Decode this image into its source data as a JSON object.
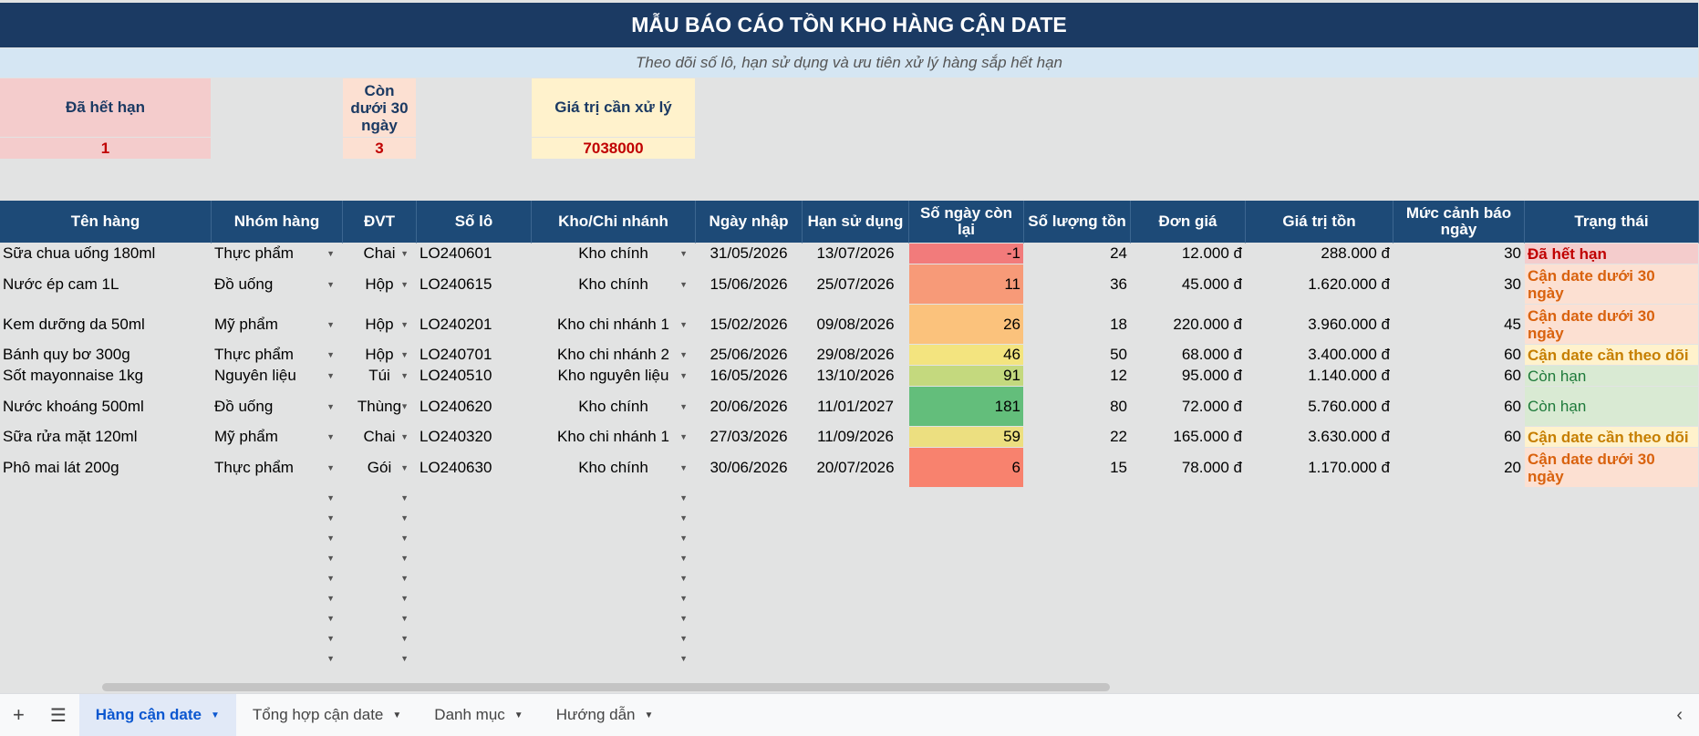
{
  "title": "MẪU BÁO CÁO TỒN KHO HÀNG CẬN DATE",
  "subtitle": "Theo dõi số lô, hạn sử dụng và ưu tiên xử lý hàng sắp hết hạn",
  "summary": {
    "expired_label": "Đã hết hạn",
    "expired_value": "1",
    "under30_label": "Còn dưới 30 ngày",
    "under30_value": "3",
    "value_label": "Giá trị cần xử lý",
    "value_value": "7038000"
  },
  "columns": [
    "Tên hàng",
    "Nhóm hàng",
    "ĐVT",
    "Số lô",
    "Kho/Chi nhánh",
    "Ngày nhập",
    "Hạn sử dụng",
    "Số ngày còn lại",
    "Số lượng tồn",
    "Đơn giá",
    "Giá trị tồn",
    "Mức cảnh báo ngày",
    "Trạng thái"
  ],
  "rows": [
    {
      "name": "Sữa chua uống 180ml",
      "group": "Thực phẩm",
      "unit": "Chai",
      "lot": "LO240601",
      "warehouse": "Kho chính",
      "in_date": "31/05/2026",
      "exp_date": "13/07/2026",
      "days": "-1",
      "qty": "24",
      "price": "12.000 đ",
      "value": "288.000 đ",
      "warn": "30",
      "status": "Đã hết hạn",
      "days_color": "#f27b7b",
      "status_type": "exp"
    },
    {
      "name": "Nước ép cam 1L",
      "group": "Đồ uống",
      "unit": "Hộp",
      "lot": "LO240615",
      "warehouse": "Kho chính",
      "in_date": "15/06/2026",
      "exp_date": "25/07/2026",
      "days": "11",
      "qty": "36",
      "price": "45.000 đ",
      "value": "1.620.000 đ",
      "warn": "30",
      "status": "Cận date dưới 30 ngày",
      "days_color": "#f79a78",
      "status_type": "soon"
    },
    {
      "name": "Kem dưỡng da 50ml",
      "group": "Mỹ phẩm",
      "unit": "Hộp",
      "lot": "LO240201",
      "warehouse": "Kho chi nhánh 1",
      "in_date": "15/02/2026",
      "exp_date": "09/08/2026",
      "days": "26",
      "qty": "18",
      "price": "220.000 đ",
      "value": "3.960.000 đ",
      "warn": "45",
      "status": "Cận date dưới 30 ngày",
      "days_color": "#fbc27c",
      "status_type": "soon"
    },
    {
      "name": "Bánh quy bơ 300g",
      "group": "Thực phẩm",
      "unit": "Hộp",
      "lot": "LO240701",
      "warehouse": "Kho chi nhánh 2",
      "in_date": "25/06/2026",
      "exp_date": "29/08/2026",
      "days": "46",
      "qty": "50",
      "price": "68.000 đ",
      "value": "3.400.000 đ",
      "warn": "60",
      "status": "Cận date cần theo dõi",
      "days_color": "#f3e47f",
      "status_type": "watch"
    },
    {
      "name": "Sốt mayonnaise 1kg",
      "group": "Nguyên liệu",
      "unit": "Túi",
      "lot": "LO240510",
      "warehouse": "Kho nguyên liệu",
      "in_date": "16/05/2026",
      "exp_date": "13/10/2026",
      "days": "91",
      "qty": "12",
      "price": "95.000 đ",
      "value": "1.140.000 đ",
      "warn": "60",
      "status": "Còn hạn",
      "days_color": "#c4d97e",
      "status_type": "ok"
    },
    {
      "name": "Nước khoáng 500ml",
      "group": "Đồ uống",
      "unit": "Thùng",
      "lot": "LO240620",
      "warehouse": "Kho chính",
      "in_date": "20/06/2026",
      "exp_date": "11/01/2027",
      "days": "181",
      "qty": "80",
      "price": "72.000 đ",
      "value": "5.760.000 đ",
      "warn": "60",
      "status": "Còn hạn",
      "days_color": "#63be7b",
      "status_type": "ok"
    },
    {
      "name": "Sữa rửa mặt 120ml",
      "group": "Mỹ phẩm",
      "unit": "Chai",
      "lot": "LO240320",
      "warehouse": "Kho chi nhánh 1",
      "in_date": "27/03/2026",
      "exp_date": "11/09/2026",
      "days": "59",
      "qty": "22",
      "price": "165.000 đ",
      "value": "3.630.000 đ",
      "warn": "60",
      "status": "Cận date cần theo dõi",
      "days_color": "#ecdf80",
      "status_type": "watch"
    },
    {
      "name": "Phô mai lát 200g",
      "group": "Thực phẩm",
      "unit": "Gói",
      "lot": "LO240630",
      "warehouse": "Kho chính",
      "in_date": "30/06/2026",
      "exp_date": "20/07/2026",
      "days": "6",
      "qty": "15",
      "price": "78.000 đ",
      "value": "1.170.000 đ",
      "warn": "20",
      "status": "Cận date dưới 30 ngày",
      "days_color": "#f8826e",
      "status_type": "soon"
    }
  ],
  "tabs": [
    {
      "label": "Hàng cận date",
      "active": true
    },
    {
      "label": "Tổng hợp cận date",
      "active": false
    },
    {
      "label": "Danh mục",
      "active": false
    },
    {
      "label": "Hướng dẫn",
      "active": false
    }
  ],
  "icons": {
    "add": "plus-icon",
    "menu": "menu-icon",
    "collapse": "chevron-left-icon"
  }
}
